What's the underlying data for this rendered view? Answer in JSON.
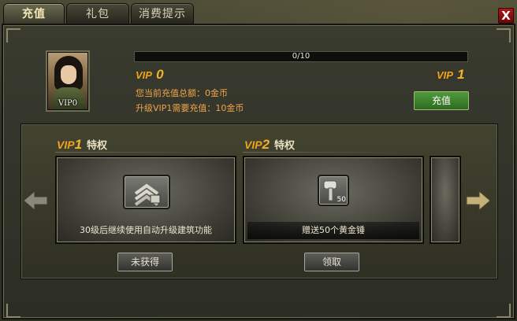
{
  "tabs": [
    {
      "label": "充值",
      "active": true
    },
    {
      "label": "礼包",
      "active": false
    },
    {
      "label": "消费提示",
      "active": false
    }
  ],
  "close_label": "X",
  "avatar": {
    "label": "VIP0"
  },
  "progress": {
    "text": "0/10",
    "current": 0,
    "max": 10
  },
  "vip_current": {
    "word": "VIP",
    "num": "0"
  },
  "vip_next": {
    "word": "VIP",
    "num": "1"
  },
  "info": {
    "total": "您当前充值总额：0金币",
    "need": "升级VIP1需要充值：10金币"
  },
  "recharge_button": "充值",
  "privileges": [
    {
      "title_word": "VIP",
      "title_num": "1",
      "title_suffix": "特权",
      "icon": "upgrade-building-icon",
      "desc": "30级后继续使用自动升级建筑功能",
      "button": "未获得"
    },
    {
      "title_word": "VIP",
      "title_num": "2",
      "title_suffix": "特权",
      "icon": "gold-hammer-icon",
      "badge": "50",
      "desc": "赠送50个黄金锤",
      "button": "领取"
    }
  ],
  "colors": {
    "accent_orange": "#f0a21a",
    "info_orange": "#f0a54a",
    "button_green": "#3f8a2f",
    "close_red": "#b01818"
  }
}
